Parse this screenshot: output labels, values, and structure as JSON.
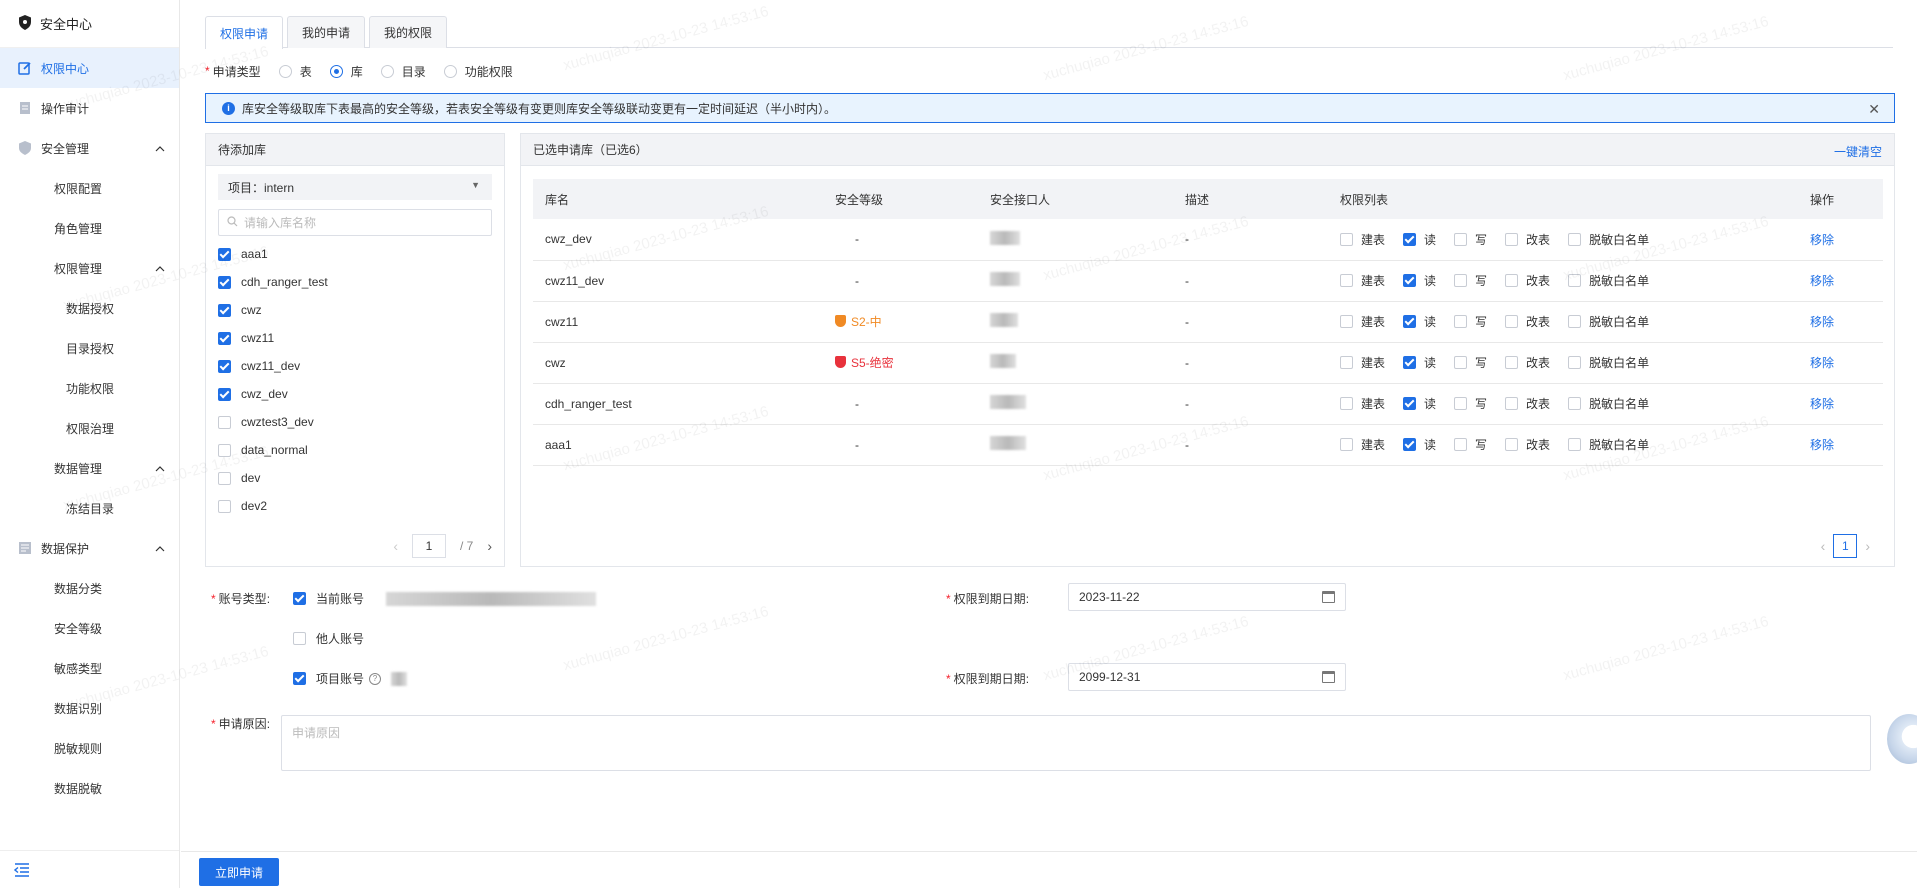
{
  "sidebar": {
    "header": "安全中心",
    "items": [
      {
        "label": "权限中心",
        "level": 0,
        "active": true,
        "icon": "edit-icon"
      },
      {
        "label": "操作审计",
        "level": 0,
        "icon": "document-icon"
      },
      {
        "label": "安全管理",
        "level": 0,
        "icon": "shield-icon",
        "expanded": true
      },
      {
        "label": "权限配置",
        "level": 1
      },
      {
        "label": "角色管理",
        "level": 1
      },
      {
        "label": "权限管理",
        "level": 1,
        "expanded": true
      },
      {
        "label": "数据授权",
        "level": 2
      },
      {
        "label": "目录授权",
        "level": 2
      },
      {
        "label": "功能权限",
        "level": 2
      },
      {
        "label": "权限治理",
        "level": 2
      },
      {
        "label": "数据管理",
        "level": 1,
        "expanded": true
      },
      {
        "label": "冻结目录",
        "level": 2
      },
      {
        "label": "数据保护",
        "level": 0,
        "icon": "data-icon",
        "expanded": true
      },
      {
        "label": "数据分类",
        "level": 1
      },
      {
        "label": "安全等级",
        "level": 1
      },
      {
        "label": "敏感类型",
        "level": 1
      },
      {
        "label": "数据识别",
        "level": 1
      },
      {
        "label": "脱敏规则",
        "level": 1
      },
      {
        "label": "数据脱敏",
        "level": 1
      }
    ]
  },
  "tabs": [
    "权限申请",
    "我的申请",
    "我的权限"
  ],
  "apply_type": {
    "label": "申请类型",
    "options": [
      "表",
      "库",
      "目录",
      "功能权限"
    ],
    "selected": "库"
  },
  "alert": {
    "text": "库安全等级取库下表最高的安全等级，若表安全等级有变更则库安全等级联动变更有一定时间延迟（半小时内）。"
  },
  "left_panel": {
    "title": "待添加库",
    "project": "项目：intern",
    "search_placeholder": "请输入库名称",
    "items": [
      {
        "name": "aaa1",
        "checked": true
      },
      {
        "name": "cdh_ranger_test",
        "checked": true
      },
      {
        "name": "cwz",
        "checked": true
      },
      {
        "name": "cwz11",
        "checked": true
      },
      {
        "name": "cwz11_dev",
        "checked": true
      },
      {
        "name": "cwz_dev",
        "checked": true
      },
      {
        "name": "cwztest3_dev",
        "checked": false
      },
      {
        "name": "data_normal",
        "checked": false
      },
      {
        "name": "dev",
        "checked": false
      },
      {
        "name": "dev2",
        "checked": false
      }
    ],
    "page": "1",
    "total_pages": "/ 7"
  },
  "right_panel": {
    "title": "已选申请库（已选6）",
    "clear_all": "一键清空",
    "columns": [
      "库名",
      "安全等级",
      "安全接口人",
      "描述",
      "权限列表",
      "操作"
    ],
    "perm_labels": [
      "建表",
      "读",
      "写",
      "改表",
      "脱敏白名单"
    ],
    "rows": [
      {
        "name": "cwz_dev",
        "level": "-",
        "level_color": "",
        "desc": "-",
        "perms": [
          false,
          true,
          false,
          false,
          false
        ],
        "action": "移除"
      },
      {
        "name": "cwz11_dev",
        "level": "-",
        "level_color": "",
        "desc": "-",
        "perms": [
          false,
          true,
          false,
          false,
          false
        ],
        "action": "移除"
      },
      {
        "name": "cwz11",
        "level": "S2-中",
        "level_color": "#f08a24",
        "desc": "-",
        "perms": [
          false,
          true,
          false,
          false,
          false
        ],
        "action": "移除"
      },
      {
        "name": "cwz",
        "level": "S5-绝密",
        "level_color": "#e8323c",
        "desc": "-",
        "perms": [
          false,
          true,
          false,
          false,
          false
        ],
        "action": "移除"
      },
      {
        "name": "cdh_ranger_test",
        "level": "-",
        "level_color": "",
        "desc": "-",
        "perms": [
          false,
          true,
          false,
          false,
          false
        ],
        "action": "移除"
      },
      {
        "name": "aaa1",
        "level": "-",
        "level_color": "",
        "desc": "-",
        "perms": [
          false,
          true,
          false,
          false,
          false
        ],
        "action": "移除"
      }
    ],
    "page": "1"
  },
  "account": {
    "label": "账号类型",
    "current": {
      "label": "当前账号",
      "checked": true
    },
    "other": {
      "label": "他人账号",
      "checked": false
    },
    "project": {
      "label": "项目账号",
      "checked": true
    },
    "expire_label": "权限到期日期",
    "expire_current": "2023-11-22",
    "expire_project": "2099-12-31"
  },
  "reason": {
    "label": "申请原因",
    "placeholder": "申请原因"
  },
  "submit_label": "立即申请",
  "watermark": "xuchuqiao 2023-10-23 14:53:16",
  "colors": {
    "primary": "#1f6fe5",
    "danger": "#e8323c",
    "warning": "#f08a24"
  }
}
